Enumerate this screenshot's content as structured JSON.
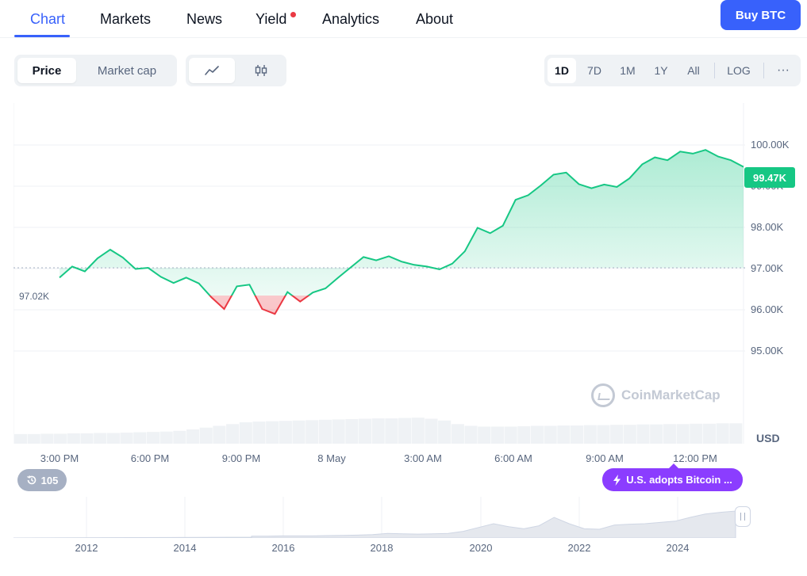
{
  "nav": {
    "tabs": [
      "Chart",
      "Markets",
      "News",
      "Yield",
      "Analytics",
      "About"
    ],
    "buy_label": "Buy BTC"
  },
  "toolbar": {
    "metric_tabs": [
      "Price",
      "Market cap"
    ],
    "view_icons": [
      "line-chart-icon",
      "candlestick-icon"
    ],
    "ranges": [
      "1D",
      "7D",
      "1M",
      "1Y",
      "All",
      "LOG"
    ],
    "more": "···"
  },
  "chart_data": {
    "type": "area",
    "x_tick_labels": [
      "3:00 PM",
      "6:00 PM",
      "9:00 PM",
      "8 May",
      "3:00 AM",
      "6:00 AM",
      "9:00 AM",
      "12:00 PM"
    ],
    "y_tick_labels": [
      "100.00K",
      "99.00K",
      "98.00K",
      "97.00K",
      "96.00K",
      "95.00K"
    ],
    "ylim": [
      94000,
      101000
    ],
    "grid": true,
    "reference_value": 97020,
    "reference_label": "97.02K",
    "current_price_label": "99.47K",
    "unit_label": "USD",
    "series": [
      {
        "values": [
          96780,
          97050,
          96930,
          97250,
          97460,
          97270,
          96990,
          97020,
          96800,
          96650,
          96780,
          96640,
          96300,
          96020,
          96570,
          96610,
          96020,
          95900,
          96430,
          96200,
          96420,
          96520,
          96780,
          97030,
          97280,
          97200,
          97300,
          97170,
          97090,
          97050,
          96980,
          97120,
          97420,
          97990,
          97860,
          98040,
          98670,
          98780,
          99020,
          99280,
          99330,
          99050,
          98950,
          99040,
          98980,
          99190,
          99530,
          99700,
          99630,
          99840,
          99790,
          99880,
          99720,
          99630,
          99470
        ],
        "up_color": "#16c784",
        "down_color": "#ea3943"
      }
    ],
    "volume": [
      0.27,
      0.27,
      0.28,
      0.28,
      0.29,
      0.29,
      0.3,
      0.3,
      0.31,
      0.32,
      0.33,
      0.34,
      0.36,
      0.4,
      0.45,
      0.5,
      0.55,
      0.6,
      0.62,
      0.63,
      0.64,
      0.65,
      0.66,
      0.67,
      0.68,
      0.69,
      0.7,
      0.71,
      0.71,
      0.72,
      0.73,
      0.7,
      0.65,
      0.55,
      0.5,
      0.48,
      0.48,
      0.48,
      0.49,
      0.5,
      0.5,
      0.51,
      0.51,
      0.52,
      0.52,
      0.53,
      0.53,
      0.54,
      0.54,
      0.55,
      0.55,
      0.56,
      0.56,
      0.57,
      0.57
    ]
  },
  "watermark": "CoinMarketCap",
  "events": {
    "history_count": "105",
    "featured": "U.S. adopts Bitcoin ..."
  },
  "navigator": {
    "years": [
      "2012",
      "2014",
      "2016",
      "2018",
      "2020",
      "2022",
      "2024"
    ],
    "history": [
      0.01,
      0.01,
      0.02,
      0.02,
      0.02,
      0.03,
      0.04,
      0.05,
      0.07,
      0.12,
      0.1,
      0.09,
      0.1,
      0.12,
      0.2,
      0.35,
      0.5,
      0.38,
      0.3,
      0.42,
      0.75,
      0.5,
      0.3,
      0.28,
      0.45,
      0.48,
      0.5,
      0.55,
      0.6,
      0.75,
      0.88,
      0.95,
      1.0
    ]
  }
}
